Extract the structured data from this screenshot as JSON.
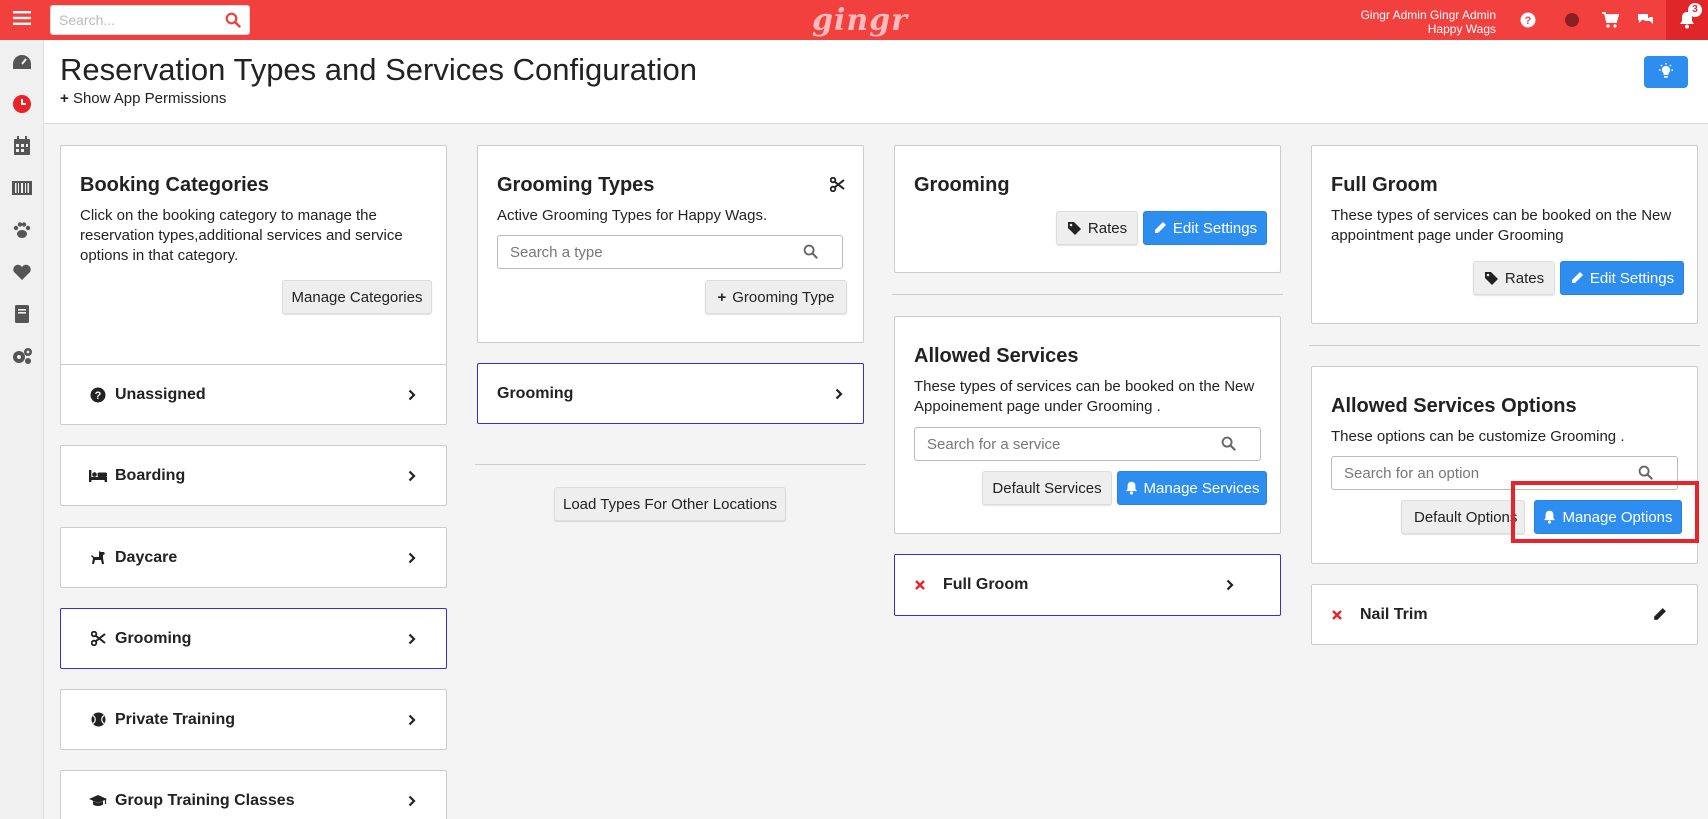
{
  "topbar": {
    "search_placeholder": "Search...",
    "logo": "gingr",
    "user_name": "Gingr Admin Gingr Admin",
    "user_location": "Happy Wags",
    "notification_count": "3"
  },
  "header": {
    "title": "Reservation Types and Services Configuration",
    "permissions_link": "Show App Permissions"
  },
  "booking_categories": {
    "title": "Booking Categories",
    "description": "Click on the booking category to manage the reservation types,additional services and service options in that category.",
    "manage_button": "Manage Categories",
    "items": [
      {
        "label": "Unassigned",
        "icon": "question-circle-icon"
      },
      {
        "label": "Boarding",
        "icon": "bed-icon"
      },
      {
        "label": "Daycare",
        "icon": "dog-icon"
      },
      {
        "label": "Grooming",
        "icon": "scissors-icon"
      },
      {
        "label": "Private Training",
        "icon": "ball-icon"
      },
      {
        "label": "Group Training Classes",
        "icon": "graduation-cap-icon"
      }
    ]
  },
  "grooming_types": {
    "title": "Grooming Types",
    "description": "Active Grooming Types for Happy Wags.",
    "search_placeholder": "Search a type",
    "add_button": "Grooming Type",
    "item": "Grooming",
    "load_button": "Load Types For Other Locations"
  },
  "grooming_settings": {
    "title": "Grooming",
    "rates_button": "Rates",
    "edit_button": "Edit Settings"
  },
  "allowed_services": {
    "title": "Allowed Services",
    "description": "These types of services can be booked on the New Appoinement page under Grooming .",
    "search_placeholder": "Search for a service",
    "default_button": "Default Services",
    "manage_button": "Manage Services",
    "item": "Full Groom"
  },
  "full_groom": {
    "title": "Full Groom",
    "description": "These types of services can be booked on the New appointment page under Grooming",
    "rates_button": "Rates",
    "edit_button": "Edit Settings"
  },
  "allowed_options": {
    "title": "Allowed Services Options",
    "description": "These options can be customize Grooming .",
    "search_placeholder": "Search for an option",
    "default_button": "Default Options",
    "manage_button": "Manage Options",
    "item": "Nail Trim"
  },
  "colors": {
    "topbar": "#f2403f",
    "primary": "#2e8ef0",
    "active_border": "#3b2bd9",
    "remove": "#e8242a"
  }
}
